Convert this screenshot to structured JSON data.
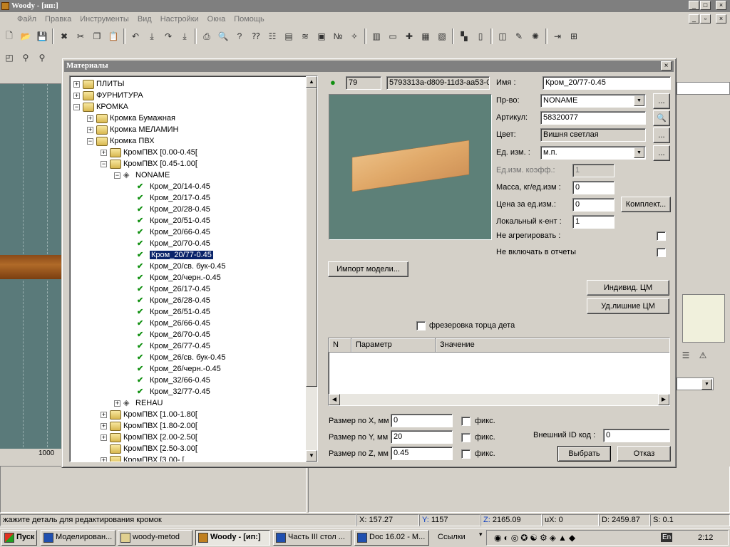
{
  "app": {
    "title": "Woody - [ип:]"
  },
  "menu": [
    "Файл",
    "Правка",
    "Инструменты",
    "Вид",
    "Настройки",
    "Окна",
    "Помощь"
  ],
  "ruler": {
    "label": "1000"
  },
  "dialog": {
    "title": "Материалы",
    "tree": {
      "items": [
        {
          "label": "ПЛИТЫ"
        },
        {
          "label": "ФУРНИТУРА"
        },
        {
          "label": "КРОМКА"
        },
        {
          "label": "Кромка Бумажная"
        },
        {
          "label": "Кромка МЕЛАМИН"
        },
        {
          "label": "Кромка ПВХ"
        },
        {
          "label": "КромПВХ [0.00-0.45["
        },
        {
          "label": "КромПВХ [0.45-1.00["
        },
        {
          "label": "NONAME"
        },
        {
          "label": "Кром_20/14-0.45"
        },
        {
          "label": "Кром_20/17-0.45"
        },
        {
          "label": "Кром_20/28-0.45"
        },
        {
          "label": "Кром_20/51-0.45"
        },
        {
          "label": "Кром_20/66-0.45"
        },
        {
          "label": "Кром_20/70-0.45"
        },
        {
          "label": "Кром_20/77-0.45"
        },
        {
          "label": "Кром_20/св. бук-0.45"
        },
        {
          "label": "Кром_20/черн.-0.45"
        },
        {
          "label": "Кром_26/17-0.45"
        },
        {
          "label": "Кром_26/28-0.45"
        },
        {
          "label": "Кром_26/51-0.45"
        },
        {
          "label": "Кром_26/66-0.45"
        },
        {
          "label": "Кром_26/70-0.45"
        },
        {
          "label": "Кром_26/77-0.45"
        },
        {
          "label": "Кром_26/св. бук-0.45"
        },
        {
          "label": "Кром_26/черн.-0.45"
        },
        {
          "label": "Кром_32/66-0.45"
        },
        {
          "label": "Кром_32/77-0.45"
        },
        {
          "label": "REHAU"
        },
        {
          "label": "КромПВХ [1.00-1.80["
        },
        {
          "label": "КромПВХ [1.80-2.00["
        },
        {
          "label": "КромПВХ [2.00-2.50["
        },
        {
          "label": "КромПВХ [2.50-3.00["
        },
        {
          "label": "КромПВХ [3.00- ["
        }
      ],
      "selected": "Кром_20/77-0.45"
    },
    "id_number": "79",
    "guid": "5793313a-d809-11d3-aa53-0",
    "fields": {
      "name_label": "Имя :",
      "name_value": "Кром_20/77-0.45",
      "maker_label": "Пр-во:",
      "maker_value": "NONAME",
      "article_label": "Артикул:",
      "article_value": "58320077",
      "color_label": "Цвет:",
      "color_value": "Вишня светлая",
      "unit_label": "Ед. изм. :",
      "unit_value": "м.п.",
      "unit_coef_label": "Ед.изм. коэфф.:",
      "unit_coef_value": "1",
      "mass_label": "Масса, кг/ед.изм :",
      "mass_value": "0",
      "price_label": "Цена за ед.изм.:",
      "price_value": "0",
      "local_coef_label": "Локальный к-ент :",
      "local_coef_value": "1",
      "no_aggregate_label": "Не агрегировать :",
      "no_reports_label": "Не включать в отчеты"
    },
    "buttons": {
      "ellipsis": "...",
      "kit": "Комплект...",
      "import_model": "Импорт модели...",
      "individual_cm": "Индивид. ЦМ",
      "remove_cm": "Уд.лишние ЦМ",
      "select": "Выбрать",
      "cancel": "Отказ"
    },
    "milling_label": "фрезеровка торца дета",
    "grid": {
      "columns": [
        "N",
        "Параметр",
        "Значение"
      ]
    },
    "sizes": {
      "x_label": "Размер по X, мм",
      "x_value": "0",
      "y_label": "Размер по Y, мм",
      "y_value": "20",
      "z_label": "Размер по Z, мм",
      "z_value": "0.45",
      "fix_label": "фикс."
    },
    "external_id_label": "Внешний ID код :",
    "external_id_value": "0"
  },
  "status": {
    "message": "жажите деталь для редактирования кромок",
    "x_label": "X:",
    "x_value": "157.27",
    "y_label": "Y:",
    "y_value": "1157",
    "z_label": "Z:",
    "z_value": "2165.09",
    "ux_label": "uX:",
    "ux_value": "0",
    "d_label": "D:",
    "d_value": "2459.87",
    "s_label": "S:",
    "s_value": "0.1"
  },
  "taskbar": {
    "start": "Пуск",
    "tasks": [
      "Моделирован...",
      "woody-metod",
      "Woody - [ип:]",
      "Часть III стол ...",
      "Doc 16.02 - М...",
      "Ссылки"
    ],
    "lang": "En",
    "clock": "2:12"
  }
}
